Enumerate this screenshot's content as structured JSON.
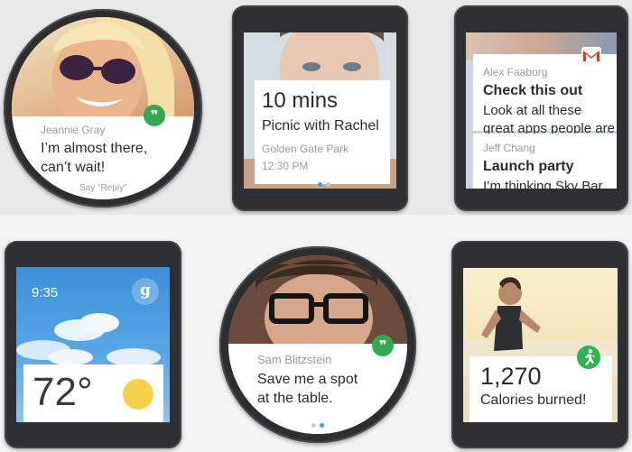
{
  "watches": {
    "jeannie": {
      "name": "Jeannie Gray",
      "line1": "I’m almost there,",
      "line2": "can’t wait!",
      "hint": "Say \"Reply\""
    },
    "picnic": {
      "time": "10 mins",
      "title": "Picnic with Rachel",
      "place": "Golden Gate Park",
      "at": "12:30 PM"
    },
    "email": {
      "msg1": {
        "sender": "Alex Faaborg",
        "subject": "Check this out",
        "line1": "Look at all these",
        "line2": "great apps people are"
      },
      "msg2": {
        "sender": "Jeff Chang",
        "subject": "Launch party",
        "line1": "I’m thinking Sky Bar"
      }
    },
    "weather": {
      "clock": "9:35",
      "temp": "72°",
      "search_glyph": "g"
    },
    "sam": {
      "name": "Sam Blitzstein",
      "line1": "Save me a spot",
      "line2": "at the table."
    },
    "fitness": {
      "value": "1,270",
      "label": "Calories burned!"
    }
  },
  "icons": {
    "hangouts": "hangouts-icon",
    "gmail": "gmail-icon",
    "google_search": "google-search-icon",
    "sun": "sun-icon",
    "running": "running-icon"
  },
  "colors": {
    "hangouts_green": "#33a852",
    "fit_green": "#2fb350",
    "accent_blue": "#35a0e6",
    "sun_yellow": "#f6d14a",
    "gmail_red": "#d23a2f"
  }
}
